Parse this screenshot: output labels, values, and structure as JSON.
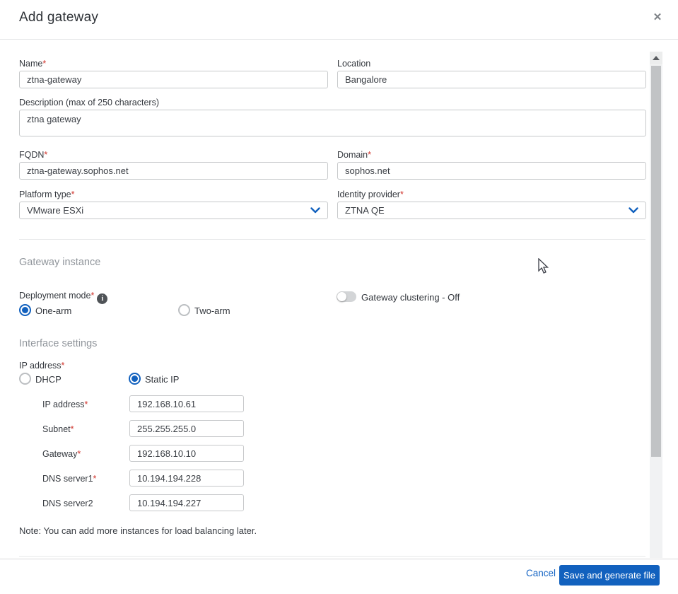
{
  "modal": {
    "title": "Add gateway"
  },
  "icons": {
    "close": "✕",
    "info": "i"
  },
  "ui": {
    "asterisk": "*"
  },
  "fields": {
    "name": {
      "label": "Name",
      "value": "ztna-gateway"
    },
    "location": {
      "label": "Location",
      "value": "Bangalore"
    },
    "description": {
      "label": "Description (max of 250 characters)",
      "value": "ztna gateway"
    },
    "fqdn": {
      "label": "FQDN",
      "value": "ztna-gateway.sophos.net"
    },
    "domain": {
      "label": "Domain",
      "value": "sophos.net"
    },
    "platform_type": {
      "label": "Platform type",
      "value": "VMware ESXi"
    },
    "identity_provider": {
      "label": "Identity provider",
      "value": "ZTNA QE"
    }
  },
  "gateway_instance": {
    "title": "Gateway instance",
    "deployment_mode_label": "Deployment mode",
    "options": [
      {
        "label": "One-arm",
        "selected": true
      },
      {
        "label": "Two-arm",
        "selected": false
      }
    ],
    "clustering_label": "Gateway clustering - Off",
    "clustering_state": "off"
  },
  "interface_settings": {
    "title": "Interface settings",
    "ip_address_label": "IP address",
    "modes": [
      {
        "label": "DHCP",
        "selected": false
      },
      {
        "label": "Static IP",
        "selected": true
      }
    ],
    "static_fields": [
      {
        "label": "IP address",
        "required": true,
        "value": "192.168.10.61"
      },
      {
        "label": "Subnet",
        "required": true,
        "value": "255.255.255.0"
      },
      {
        "label": "Gateway",
        "required": true,
        "value": "192.168.10.10"
      },
      {
        "label": "DNS server1",
        "required": true,
        "value": "10.194.194.228"
      },
      {
        "label": "DNS server2",
        "required": false,
        "value": "10.194.194.227"
      }
    ],
    "note": "Note: You can add more instances for load balancing later."
  },
  "footer": {
    "cancel_label": "Cancel",
    "save_label": "Save and generate file"
  },
  "colors": {
    "accent": "#1261be",
    "asterisk_red": "#d0342c",
    "section_title_gray": "#90959b",
    "input_border": "#c6c8ca"
  }
}
